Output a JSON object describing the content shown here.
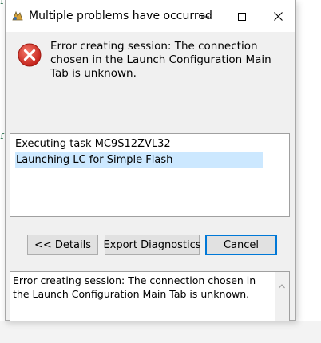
{
  "dialog": {
    "title": "Multiple problems have occurred",
    "icons": {
      "app": "eclipse-app-icon",
      "minimize": "minimize-icon",
      "maximize": "maximize-icon",
      "close": "close-icon",
      "error": "error-icon"
    },
    "message": "Error creating session: The connection chosen in the Launch Configuration Main Tab is unknown.",
    "tasks": [
      "Executing task MC9S12ZVL32",
      "Launching LC for Simple Flash"
    ],
    "selected_task_index": 1,
    "buttons": {
      "details": "<< Details",
      "export": "Export Diagnostics",
      "cancel": "Cancel"
    },
    "details_text": "Error creating session: The connection chosen in the Launch Configuration Main Tab is unknown."
  },
  "colors": {
    "selection": "#cce8ff",
    "default_button_border": "#0078d7",
    "error_red": "#d9342b",
    "dialog_bg": "#f0f0f0"
  }
}
